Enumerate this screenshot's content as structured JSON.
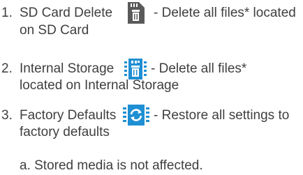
{
  "items": [
    {
      "number": "1.",
      "label": "SD Card Delete",
      "icon": "sd-card-delete-icon",
      "description_line1": "- Delete all files* located",
      "description_line2": "on SD Card"
    },
    {
      "number": "2.",
      "label": "Internal Storage",
      "icon": "internal-storage-delete-icon",
      "description_line1": "- Delete all files*",
      "description_line2": "located on Internal Storage"
    },
    {
      "number": "3.",
      "label": "Factory Defaults",
      "icon": "factory-defaults-icon",
      "description_line1": "- Restore all settings to",
      "description_line2": "factory defaults"
    }
  ],
  "note": "a. Stored media is not affected.",
  "colors": {
    "text": "#3f3f3f",
    "icon_blue": "#1f8fd3",
    "icon_gray": "#5a5a5a"
  }
}
